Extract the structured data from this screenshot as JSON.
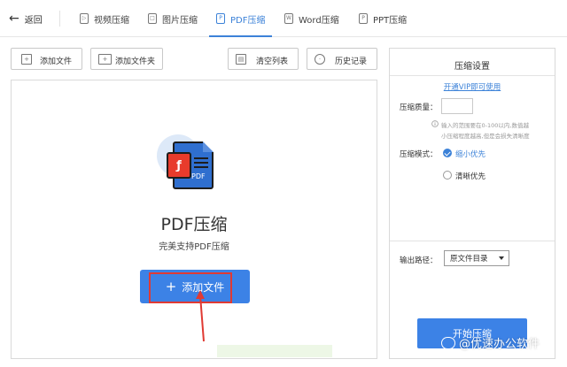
{
  "nav": {
    "back_label": "返回",
    "tabs": [
      {
        "label": "视频压缩",
        "icon": "video-icon"
      },
      {
        "label": "图片压缩",
        "icon": "image-icon"
      },
      {
        "label": "PDF压缩",
        "icon": "pdf-icon",
        "active": true
      },
      {
        "label": "Word压缩",
        "icon": "word-icon"
      },
      {
        "label": "PPT压缩",
        "icon": "ppt-icon"
      }
    ]
  },
  "toolbar": {
    "add_file": "添加文件",
    "add_folder": "添加文件夹",
    "clear_list": "清空列表",
    "history": "历史记录"
  },
  "main": {
    "title": "PDF压缩",
    "subtitle": "完美支持PDF压缩",
    "add_button": "添加文件",
    "doc_label": "PDF"
  },
  "settings": {
    "title": "压缩设置",
    "vip_link": "开通VIP即可使用",
    "quality_label": "压缩质量：",
    "quality_value": "",
    "hint_line1": "输入的范围要在0-100以内,数值越",
    "hint_line2": "小压缩程度越高,但是会损失清晰度",
    "mode_label": "压缩模式：",
    "mode_options": [
      {
        "label": "缩小优先",
        "selected": true
      },
      {
        "label": "清晰优先",
        "selected": false
      }
    ],
    "output_label": "输出路径：",
    "output_value": "原文件目录",
    "start_button": "开始压缩"
  },
  "watermark": "@优速办公软件",
  "colors": {
    "accent": "#3c82e6",
    "highlight": "#e03a33"
  }
}
